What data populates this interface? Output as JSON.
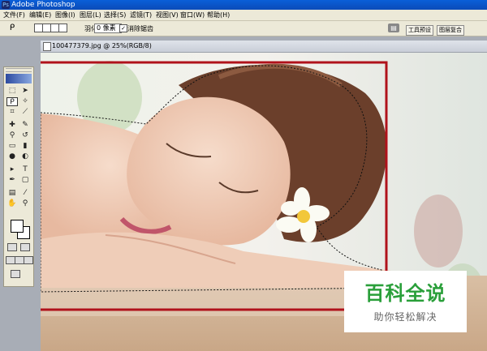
{
  "window": {
    "title": "Adobe Photoshop",
    "icon": "photoshop-app-icon"
  },
  "menubar": {
    "items": [
      "文件(F)",
      "编辑(E)",
      "图像(I)",
      "图层(L)",
      "选择(S)",
      "滤镜(T)",
      "视图(V)",
      "窗口(W)",
      "帮助(H)"
    ]
  },
  "options": {
    "tool_icon": "lasso-icon",
    "feather_label": "羽化:",
    "feather_value": "0 像素",
    "antialias_checked": true,
    "antialias_label": "消除锯齿",
    "well_tabs": [
      "工具预设",
      "图层复合"
    ],
    "printer_icon": "print-icon"
  },
  "document": {
    "tab_title": "100477379.jpg @ 25%(RGB/8)"
  },
  "toolbox": {
    "tools": [
      "marquee-icon",
      "move-icon",
      "lasso-icon",
      "magic-wand-icon",
      "crop-icon",
      "slice-icon",
      "healing-icon",
      "brush-icon",
      "clone-stamp-icon",
      "history-brush-icon",
      "eraser-icon",
      "gradient-icon",
      "blur-icon",
      "dodge-icon",
      "path-select-icon",
      "type-icon",
      "pen-icon",
      "shape-icon",
      "notes-icon",
      "eyedropper-icon",
      "hand-icon",
      "zoom-icon"
    ]
  },
  "colors": {
    "selection_box": "#b0121b",
    "watermark_green": "#2a9f3a"
  },
  "watermark": {
    "title": "百科全说",
    "subtitle": "助你轻松解决"
  }
}
